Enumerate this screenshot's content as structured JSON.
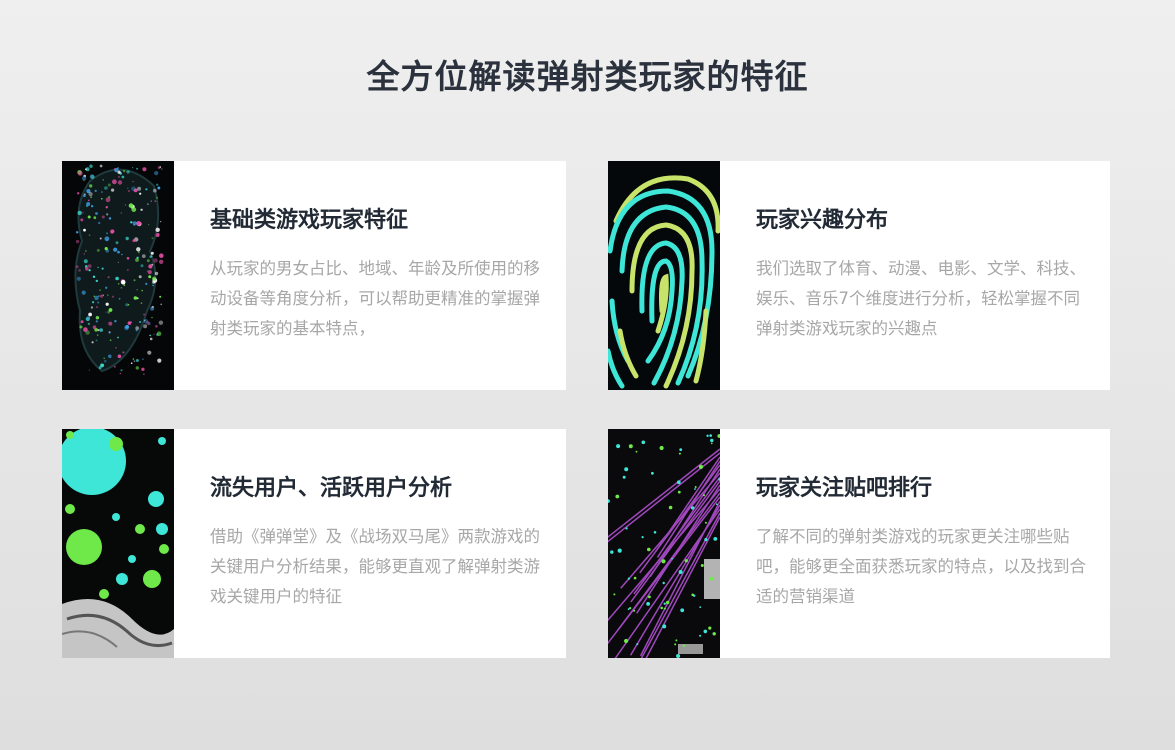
{
  "page": {
    "title": "全方位解读弹射类玩家的特征"
  },
  "cards": [
    {
      "title": "基础类游戏玩家特征",
      "description": "从玩家的男女占比、地域、年龄及所使用的移动设备等角度分析，可以帮助更精准的掌握弹射类玩家的基本特点，",
      "image": "particle-face-image"
    },
    {
      "title": "玩家兴趣分布",
      "description": "我们选取了体育、动漫、电影、文学、科技、娱乐、音乐7个维度进行分析，轻松掌握不同弹射类游戏玩家的兴趣点",
      "image": "fingerprint-image"
    },
    {
      "title": "流失用户、活跃用户分析",
      "description": "借助《弹弹堂》及《战场双马尾》两款游戏的关键用户分析结果，能够更直观了解弹射类游戏关键用户的特征",
      "image": "bubbles-image"
    },
    {
      "title": "玩家关注贴吧排行",
      "description": "了解不同的弹射类游戏的玩家更关注哪些贴吧，能够更全面获悉玩家的特点，以及找到合适的营销渠道",
      "image": "light-rays-image"
    }
  ],
  "colors": {
    "title": "#2b323d",
    "card_title": "#222a35",
    "card_text": "#a7a7a7",
    "accent_cyan": "#3ee6d8",
    "accent_green": "#6fe84a",
    "accent_yellow": "#d6e66a",
    "accent_purple": "#b04fd0"
  }
}
